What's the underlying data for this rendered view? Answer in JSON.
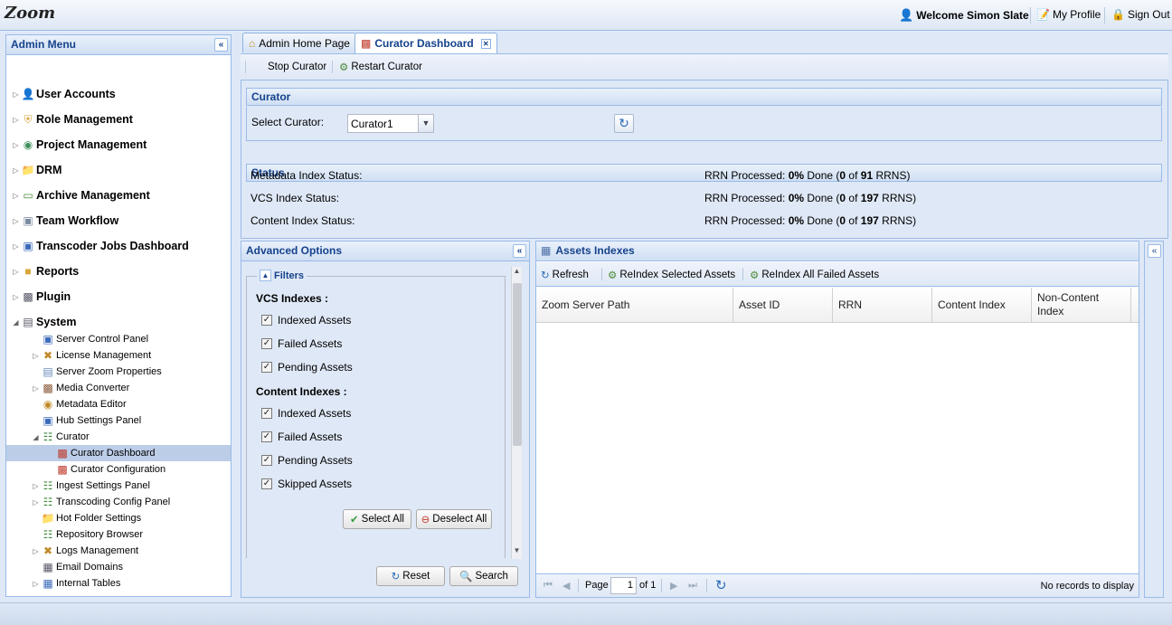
{
  "app": {
    "logo": "Zoom",
    "welcome": "Welcome Simon Slate",
    "my_profile": "My Profile",
    "sign_out": "Sign Out"
  },
  "admin_menu": {
    "title": "Admin Menu",
    "top_items": [
      {
        "label": "User Accounts",
        "icon": "user-icon"
      },
      {
        "label": "Role Management",
        "icon": "shield-icon"
      },
      {
        "label": "Project Management",
        "icon": "globe-icon"
      },
      {
        "label": "DRM",
        "icon": "folder-icon"
      },
      {
        "label": "Archive Management",
        "icon": "archive-icon"
      },
      {
        "label": "Team Workflow",
        "icon": "workflow-icon"
      },
      {
        "label": "Transcoder Jobs Dashboard",
        "icon": "monitor-icon"
      },
      {
        "label": "Reports",
        "icon": "report-icon"
      },
      {
        "label": "Plugin",
        "icon": "plugin-icon"
      },
      {
        "label": "System",
        "icon": "server-icon"
      }
    ],
    "system_children": [
      {
        "label": "Server Control Panel",
        "icon": "monitor-icon"
      },
      {
        "label": "License Management",
        "icon": "license-icon"
      },
      {
        "label": "Server Zoom Properties",
        "icon": "properties-icon"
      },
      {
        "label": "Media Converter",
        "icon": "converter-icon"
      },
      {
        "label": "Metadata Editor",
        "icon": "metadata-icon"
      },
      {
        "label": "Hub Settings Panel",
        "icon": "monitor-icon"
      },
      {
        "label": "Curator",
        "icon": "hierarchy-icon"
      },
      {
        "label": "Curator Dashboard",
        "icon": "chart-icon"
      },
      {
        "label": "Curator Configuration",
        "icon": "chart-icon"
      },
      {
        "label": "Ingest Settings Panel",
        "icon": "hierarchy-icon"
      },
      {
        "label": "Transcoding Config Panel",
        "icon": "hierarchy-icon"
      },
      {
        "label": "Hot Folder Settings",
        "icon": "folder-icon"
      },
      {
        "label": "Repository Browser",
        "icon": "hierarchy-icon"
      },
      {
        "label": "Logs Management",
        "icon": "logs-icon"
      },
      {
        "label": "Email Domains",
        "icon": "email-icon"
      },
      {
        "label": "Internal Tables",
        "icon": "table-icon"
      }
    ]
  },
  "tabs": [
    {
      "label": "Admin Home Page",
      "icon": "home-icon"
    },
    {
      "label": "Curator Dashboard",
      "icon": "chart-icon"
    }
  ],
  "toolbar": {
    "stop": "Stop Curator",
    "restart": "Restart Curator"
  },
  "curator": {
    "title": "Curator",
    "select_label": "Select Curator:",
    "selected_value": "Curator1"
  },
  "status": {
    "title": "Status",
    "rows": [
      {
        "label": "Metadata Index Status:",
        "prefix": "RRN Processed: ",
        "pct": "0%",
        "done": " Done (",
        "n": "0",
        "of": " of ",
        "total": "91",
        "suffix": " RRNS)"
      },
      {
        "label": "VCS Index Status:",
        "prefix": "RRN Processed: ",
        "pct": "0%",
        "done": " Done (",
        "n": "0",
        "of": " of ",
        "total": "197",
        "suffix": " RRNS)"
      },
      {
        "label": "Content Index Status:",
        "prefix": "RRN Processed: ",
        "pct": "0%",
        "done": " Done (",
        "n": "0",
        "of": " of ",
        "total": "197",
        "suffix": " RRNS)"
      }
    ]
  },
  "advanced": {
    "title": "Advanced Options",
    "filters_label": "Filters",
    "vcs_heading": "VCS Indexes :",
    "vcs_items": [
      "Indexed Assets",
      "Failed Assets",
      "Pending Assets"
    ],
    "content_heading": "Content Indexes :",
    "content_items": [
      "Indexed Assets",
      "Failed Assets",
      "Pending Assets",
      "Skipped Assets"
    ],
    "select_all": "Select All",
    "deselect_all": "Deselect All",
    "reset": "Reset",
    "search": "Search"
  },
  "assets": {
    "title": "Assets Indexes",
    "refresh": "Refresh",
    "reindex_selected": "ReIndex Selected Assets",
    "reindex_failed": "ReIndex All Failed Assets",
    "columns": [
      "Zoom Server Path",
      "Asset ID",
      "RRN",
      "Content Index",
      "Non-Content Index"
    ],
    "paging": {
      "page_label": "Page",
      "page_value": "1",
      "of_label": "of 1",
      "empty": "No records to display"
    }
  }
}
